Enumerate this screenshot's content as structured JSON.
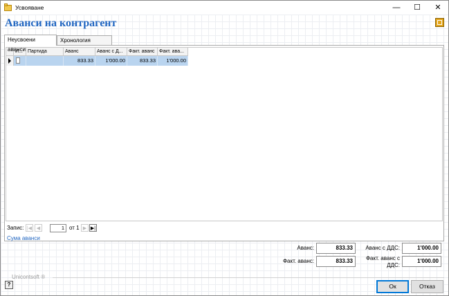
{
  "window": {
    "title": "Усвояване",
    "minimize": "—",
    "maximize": "☐",
    "close": "✕"
  },
  "page": {
    "title": "Аванси на контрагент"
  },
  "tabs": [
    {
      "label": "Неусвоени аванси",
      "active": true
    },
    {
      "label": "Хронология аванси",
      "active": false
    }
  ],
  "grid": {
    "columns": [
      "И...",
      "Партида",
      "Аванс",
      "Аванс с Д...",
      "Факт. аванс",
      "Факт. ава..."
    ],
    "rows": [
      {
        "partida": "",
        "avans": "833.33",
        "avans_dds": "1'000.00",
        "fakt_avans": "833.33",
        "fakt_avans_dds": "1'000.00"
      }
    ]
  },
  "navigator": {
    "label": "Запис:",
    "current": "1",
    "of_text": "от 1"
  },
  "summary_link": "Сума аванси",
  "summary": {
    "avans_label": "Аванс:",
    "avans_value": "833.33",
    "avans_dds_label": "Аванс с ДДС:",
    "avans_dds_value": "1'000.00",
    "fakt_label": "Факт. аванс:",
    "fakt_value": "833.33",
    "fakt_dds_label": "Факт. аванс с ДДС:",
    "fakt_dds_value": "1'000.00"
  },
  "footer": {
    "brand": "Unicontsoft ®",
    "help": "?",
    "ok": "Ок",
    "cancel": "Отказ"
  },
  "colors": {
    "accent": "#2166c1",
    "selection": "#b9d4ef"
  }
}
